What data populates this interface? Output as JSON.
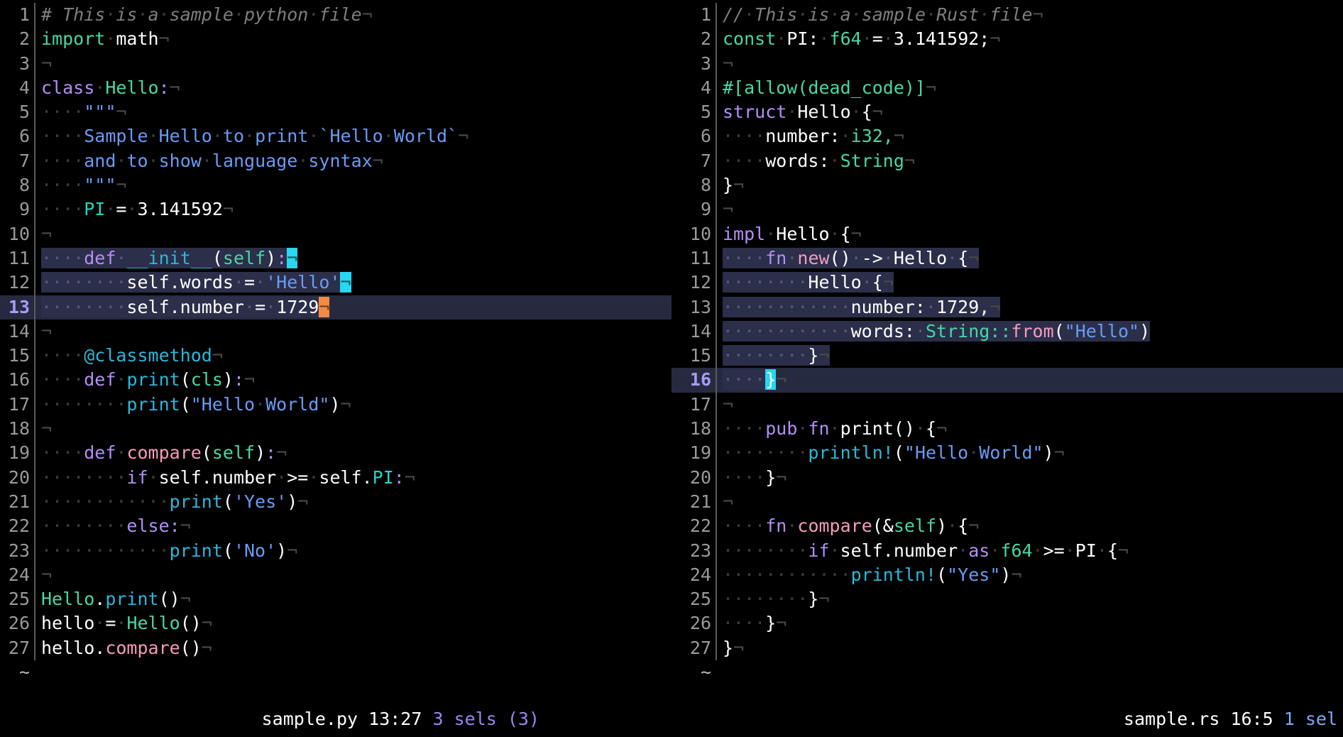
{
  "app": {
    "name": "helix-editor",
    "theme_background": "#000000",
    "selection_color": "#2b2f4a",
    "cursor_primary_color": "#f08b48",
    "cursor_secondary_color": "#28d7f0"
  },
  "panes": [
    {
      "id": "left-pane",
      "filename": "sample.py",
      "language": "python",
      "cursor_position": "13:27",
      "selection_status": "3 sels (3)",
      "placeholder_row": "~",
      "lines": [
        {
          "n": 1,
          "text": "# This is a sample python file"
        },
        {
          "n": 2,
          "text": "import math"
        },
        {
          "n": 3,
          "text": ""
        },
        {
          "n": 4,
          "text": "class Hello:"
        },
        {
          "n": 5,
          "text": "    \"\"\""
        },
        {
          "n": 6,
          "text": "    Sample Hello to print `Hello World`"
        },
        {
          "n": 7,
          "text": "    and to show language syntax"
        },
        {
          "n": 8,
          "text": "    \"\"\""
        },
        {
          "n": 9,
          "text": "    PI = 3.141592"
        },
        {
          "n": 10,
          "text": ""
        },
        {
          "n": 11,
          "text": "    def __init__(self):"
        },
        {
          "n": 12,
          "text": "        self.words = 'Hello'"
        },
        {
          "n": 13,
          "text": "        self.number = 1729"
        },
        {
          "n": 14,
          "text": ""
        },
        {
          "n": 15,
          "text": "    @classmethod"
        },
        {
          "n": 16,
          "text": "    def print(cls):"
        },
        {
          "n": 17,
          "text": "        print(\"Hello World\")"
        },
        {
          "n": 18,
          "text": ""
        },
        {
          "n": 19,
          "text": "    def compare(self):"
        },
        {
          "n": 20,
          "text": "        if self.number >= self.PI:"
        },
        {
          "n": 21,
          "text": "            print('Yes')"
        },
        {
          "n": 22,
          "text": "        else:"
        },
        {
          "n": 23,
          "text": "            print('No')"
        },
        {
          "n": 24,
          "text": ""
        },
        {
          "n": 25,
          "text": "Hello.print()"
        },
        {
          "n": 26,
          "text": "hello = Hello()"
        },
        {
          "n": 27,
          "text": "hello.compare()"
        }
      ]
    },
    {
      "id": "right-pane",
      "filename": "sample.rs",
      "language": "rust",
      "cursor_position": "16:5",
      "selection_status": "1 sel",
      "placeholder_row": "~",
      "lines": [
        {
          "n": 1,
          "text": "// This is a sample Rust file"
        },
        {
          "n": 2,
          "text": "const PI: f64 = 3.141592;"
        },
        {
          "n": 3,
          "text": ""
        },
        {
          "n": 4,
          "text": "#[allow(dead_code)]"
        },
        {
          "n": 5,
          "text": "struct Hello {"
        },
        {
          "n": 6,
          "text": "    number: i32,"
        },
        {
          "n": 7,
          "text": "    words: String"
        },
        {
          "n": 8,
          "text": "}"
        },
        {
          "n": 9,
          "text": ""
        },
        {
          "n": 10,
          "text": "impl Hello {"
        },
        {
          "n": 11,
          "text": "    fn new() -> Hello {"
        },
        {
          "n": 12,
          "text": "        Hello {"
        },
        {
          "n": 13,
          "text": "            number: 1729,"
        },
        {
          "n": 14,
          "text": "            words: String::from(\"Hello\")"
        },
        {
          "n": 15,
          "text": "        }"
        },
        {
          "n": 16,
          "text": "    }"
        },
        {
          "n": 17,
          "text": ""
        },
        {
          "n": 18,
          "text": "    pub fn print() {"
        },
        {
          "n": 19,
          "text": "        println!(\"Hello World\")"
        },
        {
          "n": 20,
          "text": "    }"
        },
        {
          "n": 21,
          "text": ""
        },
        {
          "n": 22,
          "text": "    fn compare(&self) {"
        },
        {
          "n": 23,
          "text": "        if self.number as f64 >= PI {"
        },
        {
          "n": 24,
          "text": "            println!(\"Yes\")"
        },
        {
          "n": 25,
          "text": "        }"
        },
        {
          "n": 26,
          "text": "    }"
        },
        {
          "n": 27,
          "text": "}"
        }
      ]
    }
  ],
  "statusbar": {
    "left": {
      "filename": "sample.py",
      "position": "13:27",
      "selections": "3 sels (3)"
    },
    "right": {
      "filename": "sample.rs",
      "position": "16:5",
      "selections": "1 sel"
    }
  }
}
